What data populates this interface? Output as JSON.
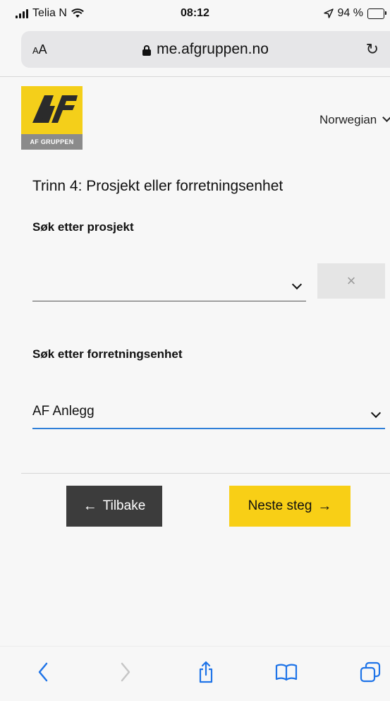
{
  "status_bar": {
    "carrier": "Telia N",
    "time": "08:12",
    "battery_percent": "94 %"
  },
  "browser": {
    "text_size_label_small": "A",
    "text_size_label_large": "A",
    "url": "me.afgruppen.no",
    "reload_icon": "↻"
  },
  "brand": {
    "logo_text": "AF GRUPPEN",
    "logo_colors": {
      "primary": "#f4cf1a",
      "footer": "#8b8b8b"
    }
  },
  "language_selector": {
    "label": "Norwegian"
  },
  "page": {
    "step_title": "Trinn 4: Prosjekt eller forretningsenhet"
  },
  "project_search": {
    "label": "Søk etter prosjekt",
    "value": "",
    "clear_symbol": "×"
  },
  "business_unit_search": {
    "label": "Søk etter forretningsenhet",
    "value": "AF Anlegg"
  },
  "buttons": {
    "back_arrow": "←",
    "back_label": "Tilbake",
    "next_label": "Neste steg",
    "next_arrow": "→"
  },
  "colors": {
    "accent_yellow": "#f8cf16",
    "dark_button": "#3c3c3c",
    "focus_blue": "#2f7fd8",
    "toolbar_blue": "#1f74e8"
  },
  "toolbar": {
    "back_icon": "back-icon",
    "forward_icon": "forward-icon",
    "share_icon": "share-icon",
    "bookmarks_icon": "bookmarks-icon",
    "tabs_icon": "tabs-icon"
  }
}
